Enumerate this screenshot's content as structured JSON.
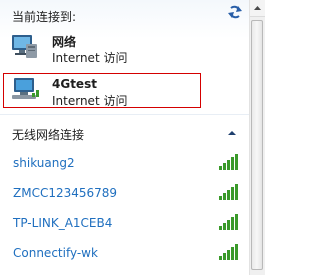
{
  "connected": {
    "title": "当前连接到:",
    "connections": [
      {
        "name": "网络",
        "status": "Internet 访问",
        "icon": "wired-network-icon"
      },
      {
        "name": "4Gtest",
        "status": "Internet 访问",
        "icon": "mobile-broadband-icon"
      }
    ]
  },
  "wireless": {
    "title": "无线网络连接",
    "networks": [
      {
        "name": "shikuang2",
        "signal_bars": 5
      },
      {
        "name": "ZMCC123456789",
        "signal_bars": 5
      },
      {
        "name": "TP-LINK_A1CEB4",
        "signal_bars": 5
      },
      {
        "name": "Connectify-wk",
        "signal_bars": 5
      }
    ]
  },
  "colors": {
    "link": "#1f6fbf",
    "highlight_border": "#d40000",
    "signal_green": "#3a9a2a"
  }
}
